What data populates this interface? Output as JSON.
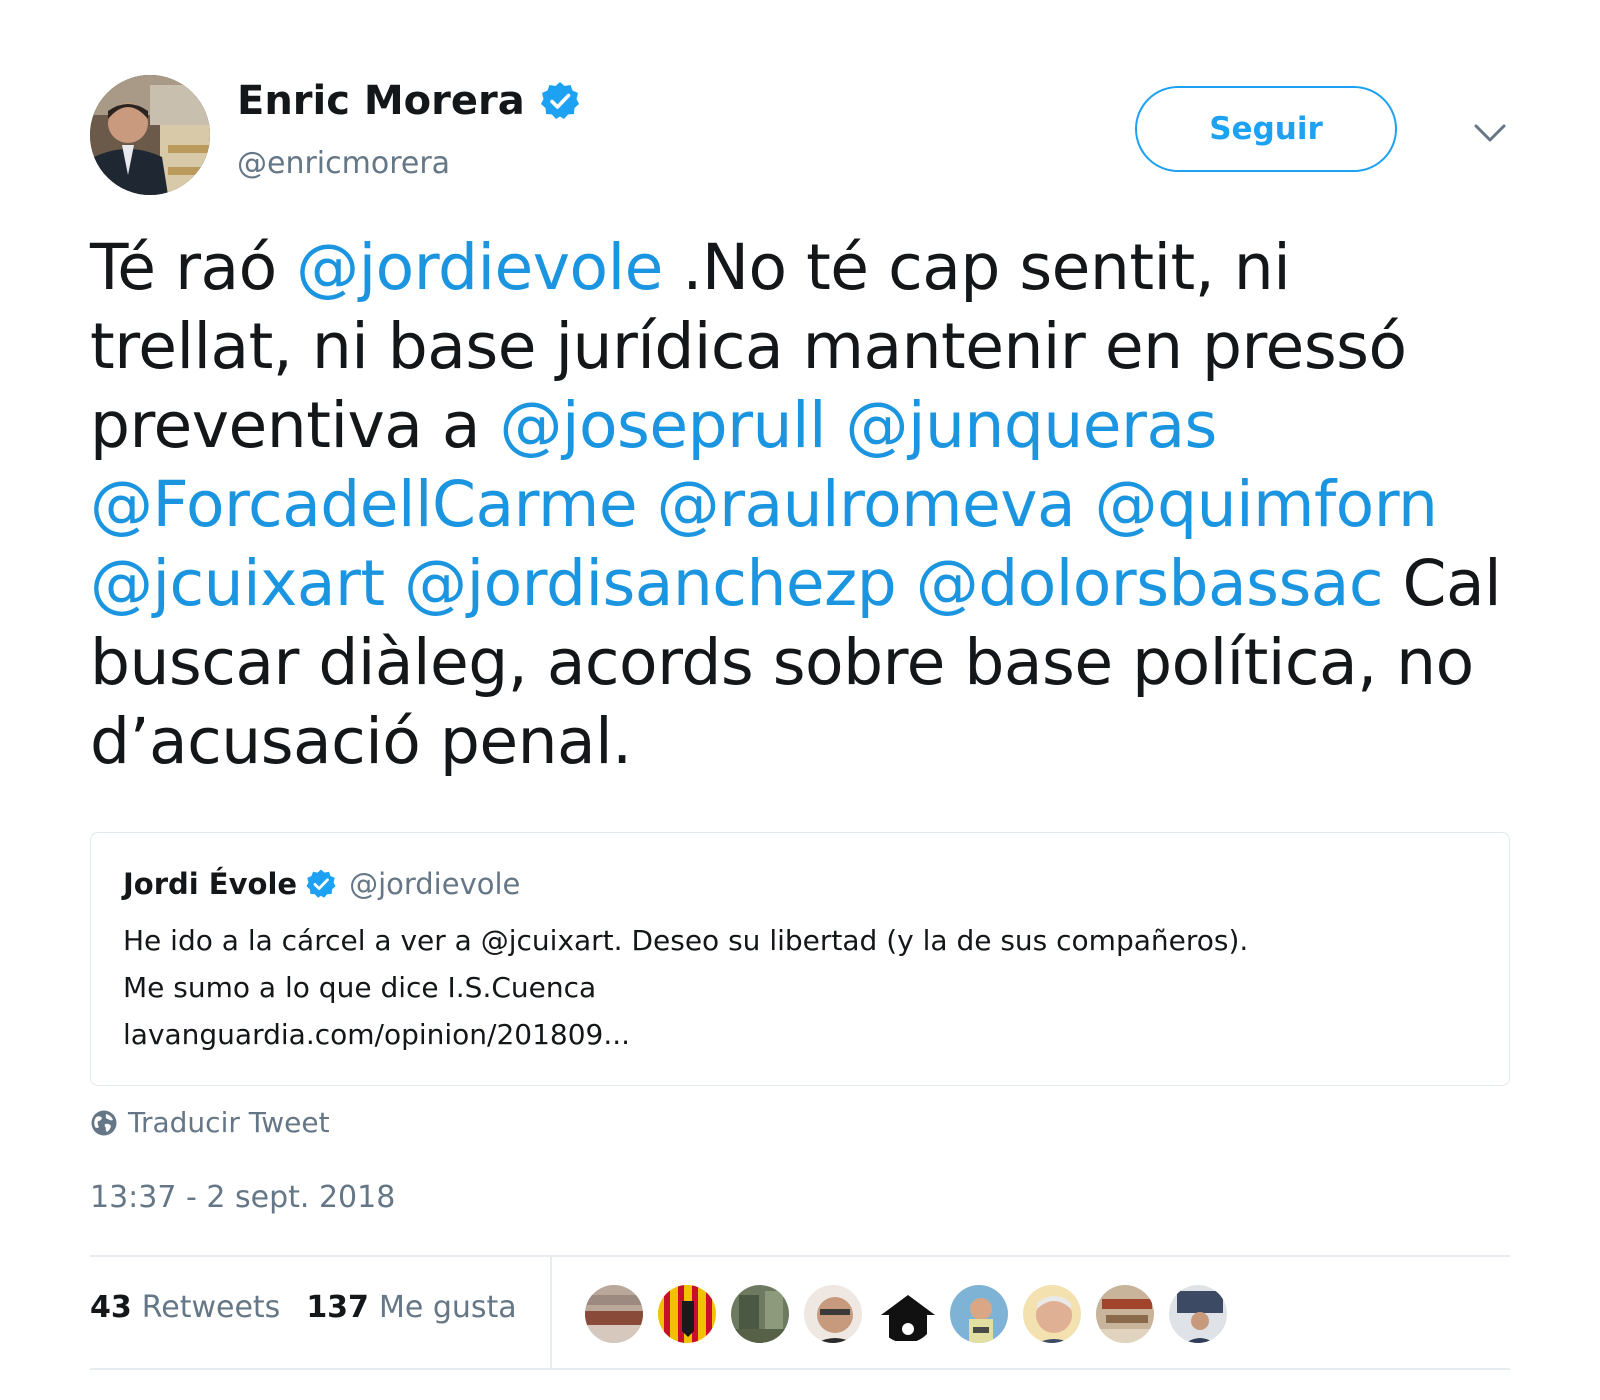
{
  "tweet": {
    "author": {
      "name": "Enric Morera",
      "handle": "@enricmorera",
      "verified": true
    },
    "follow_label": "Seguir",
    "menu_icon": "chevron-down-icon",
    "text_segments": [
      {
        "text": "Té raó ",
        "type": "text"
      },
      {
        "text": "@jordievole",
        "type": "mention"
      },
      {
        "text": " .No té cap sentit,  ni trellat, ni base jurídica mantenir en pressó preventiva a ",
        "type": "text"
      },
      {
        "text": "@joseprull",
        "type": "mention"
      },
      {
        "text": " ",
        "type": "text"
      },
      {
        "text": "@junqueras",
        "type": "mention"
      },
      {
        "text": " ",
        "type": "text"
      },
      {
        "text": "@ForcadellCarme",
        "type": "mention"
      },
      {
        "text": " ",
        "type": "text"
      },
      {
        "text": "@raulromeva",
        "type": "mention"
      },
      {
        "text": " ",
        "type": "text"
      },
      {
        "text": "@quimforn",
        "type": "mention"
      },
      {
        "text": " ",
        "type": "text"
      },
      {
        "text": "@jcuixart",
        "type": "mention"
      },
      {
        "text": " ",
        "type": "text"
      },
      {
        "text": "@jordisanchezp",
        "type": "mention"
      },
      {
        "text": " ",
        "type": "text"
      },
      {
        "text": "@dolorsbassac",
        "type": "mention"
      },
      {
        "text": " Cal buscar diàleg, acords sobre base política, no d’acusació penal.",
        "type": "text"
      }
    ],
    "quoted": {
      "name": "Jordi Évole",
      "handle": "@jordievole",
      "verified": true,
      "lines": [
        "He ido a la cárcel a ver a @jcuixart. Deseo su libertad (y la de sus compañeros).",
        "Me sumo a lo que dice I.S.Cuenca",
        "lavanguardia.com/opinion/201809..."
      ]
    },
    "translate_label": "Traducir Tweet",
    "timestamp": "13:37 - 2 sept. 2018",
    "stats": {
      "retweets_count": "43",
      "retweets_label": "Retweets",
      "likes_count": "137",
      "likes_label": "Me gusta"
    },
    "likers_count": 9
  },
  "colors": {
    "accent": "#1da1f2",
    "mention": "#1b95e0",
    "text": "#14171a",
    "secondary": "#657786",
    "border": "#e1e8ed"
  }
}
